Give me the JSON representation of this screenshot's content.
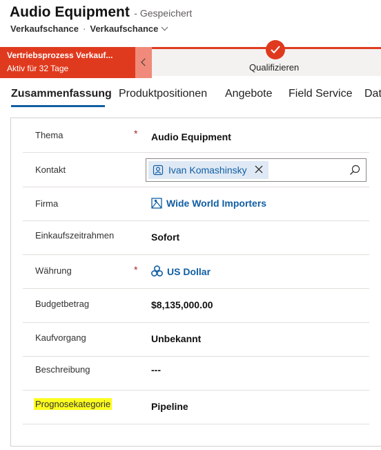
{
  "header": {
    "title": "Audio Equipment",
    "saved_status": "- Gespeichert",
    "entity": "Verkaufschance",
    "separator": "·",
    "form_selector": "Verkaufschance"
  },
  "process": {
    "name": "Vertriebsprozess Verkauf...",
    "age": "Aktiv für 32 Tage",
    "active_stage": "Qualifizieren",
    "accent_color": "#e03a1e"
  },
  "tabs": [
    {
      "label": "Zusammenfassung",
      "active": true
    },
    {
      "label": "Produktpositionen"
    },
    {
      "label": "Angebote"
    },
    {
      "label": "Field Service"
    },
    {
      "label": "Dat"
    }
  ],
  "fields": {
    "topic": {
      "label": "Thema",
      "required": "*",
      "value": "Audio Equipment"
    },
    "contact": {
      "label": "Kontakt",
      "value": "Ivan Komashinsky",
      "icon": "contact-icon"
    },
    "account": {
      "label": "Firma",
      "value": "Wide World Importers",
      "icon": "account-icon"
    },
    "purchase_timeframe": {
      "label": "Einkaufszeitrahmen",
      "value": "Sofort"
    },
    "currency": {
      "label": "Währung",
      "required": "*",
      "value": "US Dollar",
      "icon": "currency-icon"
    },
    "budget": {
      "label": "Budgetbetrag",
      "value": "$8,135,000.00"
    },
    "purchase_process": {
      "label": "Kaufvorgang",
      "value": "Unbekannt"
    },
    "description": {
      "label": "Beschreibung",
      "value": "---"
    },
    "forecast_category": {
      "label": "Prognosekategorie",
      "value": "Pipeline",
      "highlight_color": "#fdfd20"
    }
  }
}
